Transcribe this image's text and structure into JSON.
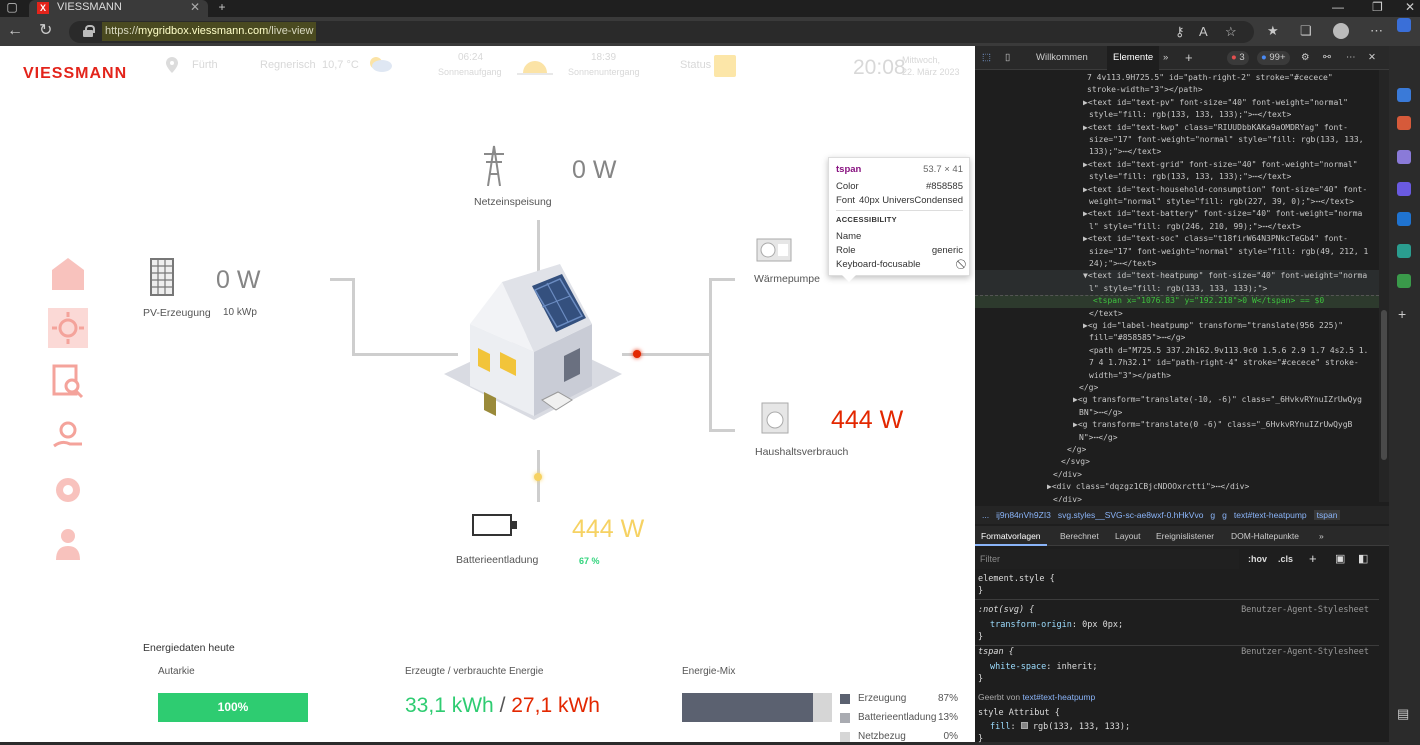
{
  "browser": {
    "tab_title": "VIESSMANN",
    "favicon_letter": "X",
    "url_prefix": "https://",
    "url_host": "mygridbox.viessmann.com",
    "url_path": "/live-view",
    "new_tab_glyph": "+",
    "window_controls": [
      "—",
      "❐",
      "✕"
    ]
  },
  "header": {
    "logo": "VIESSMANN",
    "city": "Fürth",
    "weather": "Regnerisch",
    "temperature": "10,7 °C",
    "sunrise_time": "06:24",
    "sunrise_label": "Sonnenaufgang",
    "sunset_time": "18:39",
    "sunset_label": "Sonnenuntergang",
    "status_label": "Status",
    "clock": "20:08",
    "weekday": "Mittwoch,",
    "date": "22. März 2023"
  },
  "diagram": {
    "grid_value": "0 W",
    "grid_label": "Netzeinspeisung",
    "pv_value": "0 W",
    "pv_label": "PV-Erzeugung",
    "pv_kwp": "10 kWp",
    "heatpump_value": "0 W",
    "heatpump_label": "Wärmepumpe",
    "household_value": "444 W",
    "household_label": "Haushaltsverbrauch",
    "battery_value": "444 W",
    "battery_label": "Batterieentladung",
    "battery_soc": "67 %"
  },
  "energy_today": {
    "title": "Energiedaten heute",
    "autarkie_label": "Autarkie",
    "autarkie_value": "100%",
    "autarkie_fraction": 1.0,
    "energy_label": "Erzeugte / verbrauchte Energie",
    "produced": "33,1 kWh",
    "separator": "/",
    "consumed": "27,1 kWh",
    "mix_label": "Energie-Mix",
    "mix_fill_fraction": 0.87,
    "mix": [
      {
        "name": "Erzeugung",
        "pct": "87%",
        "color": "#5b6170"
      },
      {
        "name": "Batterieentladung",
        "pct": "13%",
        "color": "#a9abb1"
      },
      {
        "name": "Netzbezug",
        "pct": "0%",
        "color": "#d6d6d6"
      }
    ]
  },
  "tooltip": {
    "tag": "tspan",
    "size": "53.7 × 41",
    "color_label": "Color",
    "color_value": "#858585",
    "font_label": "Font",
    "font_value": "40px UniversCondensed",
    "accessibility_heading": "ACCESSIBILITY",
    "name_label": "Name",
    "role_label": "Role",
    "role_value": "generic",
    "keyboard_label": "Keyboard-focusable"
  },
  "devtools": {
    "tabs": [
      "Willkommen",
      "Elemente",
      "»",
      "+"
    ],
    "error_count": "3",
    "warning_count": "99+",
    "dom_lines": [
      "7 4v113.9H725.5\" id=\"path-right-2\" stroke=\"#cecece\"",
      "stroke-width=\"3\"></path>",
      "▶<text id=\"text-pv\" font-size=\"40\" font-weight=\"normal\"",
      "style=\"fill: rgb(133, 133, 133);\">⋯</text>",
      "▶<text id=\"text-kwp\" class=\"RIUUDbbKAKa9aOMDRYag\" font-",
      "size=\"17\" font-weight=\"normal\" style=\"fill: rgb(133, 133,",
      "133);\">⋯</text>",
      "▶<text id=\"text-grid\" font-size=\"40\" font-weight=\"normal\"",
      "style=\"fill: rgb(133, 133, 133);\">⋯</text>",
      "▶<text id=\"text-household-consumption\" font-size=\"40\" font-",
      "weight=\"normal\" style=\"fill: rgb(227, 39, 0);\">⋯</text>",
      "▶<text id=\"text-battery\" font-size=\"40\" font-weight=\"norma",
      "l\" style=\"fill: rgb(246, 210, 99);\">⋯</text>",
      "▶<text id=\"text-soc\" class=\"t18firW64N3PNkcTeGb4\" font-",
      "size=\"17\" font-weight=\"normal\" style=\"fill: rgb(49, 212, 1",
      "24);\">⋯</text>",
      "▼<text id=\"text-heatpump\" font-size=\"40\" font-weight=\"norma",
      "l\" style=\"fill: rgb(133, 133, 133);\">",
      "<tspan x=\"1076.83\" y=\"192.218\">0 W</tspan> == $0",
      "</text>",
      "▶<g id=\"label-heatpump\" transform=\"translate(956 225)\"",
      "fill=\"#858585\">⋯</g>",
      "<path d=\"M725.5 337.2h162.9v113.9c0 1.5.6 2.9 1.7 4s2.5 1.",
      "7 4 1.7h32.1\" id=\"path-right-4\" stroke=\"#cecece\" stroke-",
      "width=\"3\"></path>",
      "</g>",
      "▶<g transform=\"translate(-10, -6)\" class=\"_6HvkvRYnuIZrUwQyg",
      "BN\">⋯</g>",
      "▶<g transform=\"translate(0 -6)\" class=\"_6HvkvRYnuIZrUwQygB",
      "N\">⋯</g>",
      "</g>",
      "</svg>",
      "</div>",
      "▶<div class=\"dqzgz1CBjcNDOOxrctti\">⋯</div>",
      "</div>",
      "</div>"
    ],
    "breadcrumbs": [
      "...",
      "ij9n84nVh9ZI3",
      "svg.styles__SVG-sc-ae8wxf-0.hHkVvo",
      "g",
      "g",
      "text#text-heatpump",
      "tspan"
    ],
    "sub_tabs": [
      "Formatvorlagen",
      "Berechnet",
      "Layout",
      "Ereignislistener",
      "DOM-Haltepunkte",
      "»"
    ],
    "filter_placeholder": "Filter",
    "hov": ":hov",
    "cls": ".cls",
    "styles": {
      "element_style": "element.style {",
      "close": "}",
      "not_svg": ":not(svg) {",
      "not_svg_prop": "transform-origin",
      "not_svg_val": "0px 0px;",
      "ua_sheet": "Benutzer-Agent-Stylesheet",
      "tspan_rule": "tspan {",
      "tspan_prop": "white-space",
      "tspan_val": "inherit;",
      "inherited": "Geerbt von",
      "inherited_from": "text#text-heatpump",
      "style_attr": "style Attribut {",
      "fill_prop": "fill",
      "fill_val": "rgb(133, 133, 133);"
    }
  }
}
